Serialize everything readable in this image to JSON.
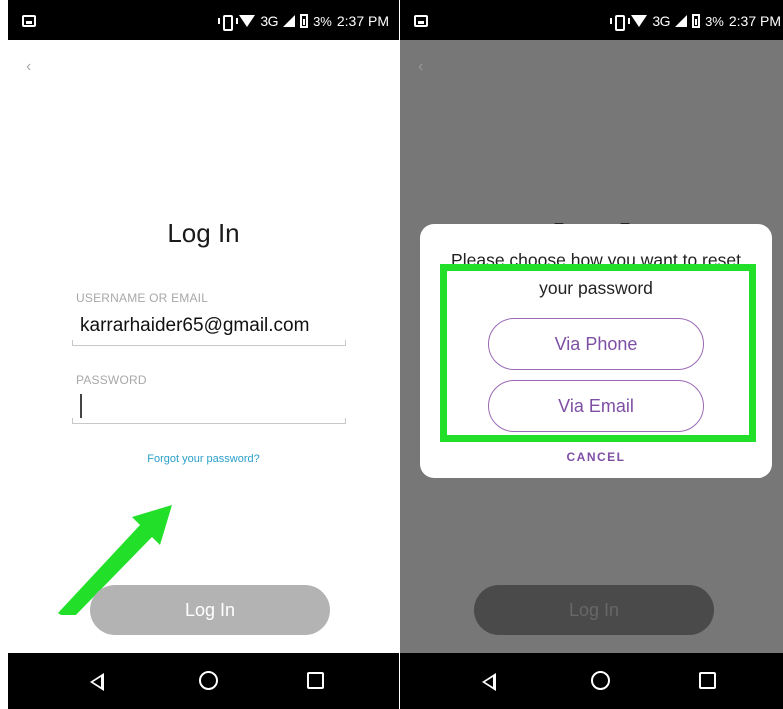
{
  "status_bar": {
    "network": "3G",
    "battery": "3%",
    "time": "2:37 PM"
  },
  "left_screen": {
    "back_glyph": "‹",
    "title": "Log In",
    "username_label": "USERNAME OR EMAIL",
    "username_value": "karrarhaider65@gmail.com",
    "password_label": "PASSWORD",
    "forgot_link": "Forgot your password?",
    "login_button": "Log In"
  },
  "right_screen": {
    "back_glyph": "‹",
    "dialog": {
      "message": "Please choose how you want to reset your password",
      "via_phone": "Via Phone",
      "via_email": "Via Email",
      "cancel": "CANCEL"
    },
    "login_button": "Log In"
  },
  "colors": {
    "highlight": "#22e02a",
    "accent_purple": "#7e4fa4",
    "link_blue": "#2aa0c8",
    "button_gray": "#b3b3b3",
    "overlay_gray": "#777777"
  },
  "icons": [
    "back-chevron-icon",
    "gallery-icon",
    "vibrate-icon",
    "wifi-icon",
    "signal-icon",
    "battery-icon",
    "nav-back-icon",
    "nav-home-icon",
    "nav-recents-icon",
    "green-arrow-annotation"
  ]
}
